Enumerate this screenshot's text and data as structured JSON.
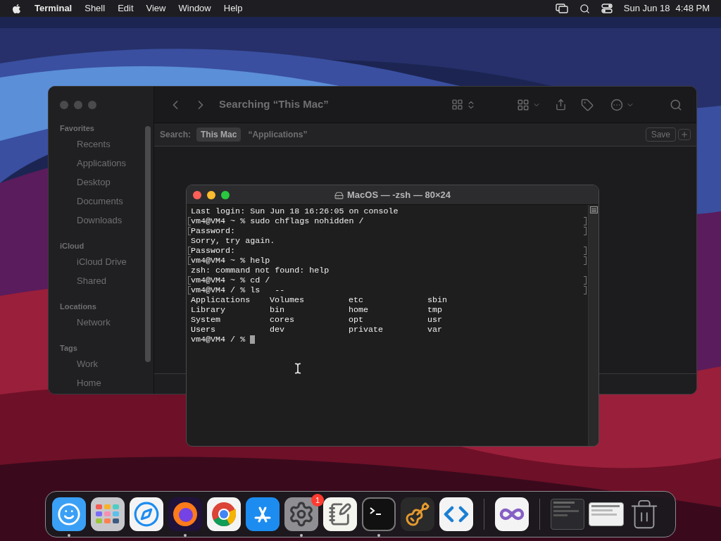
{
  "menu_bar": {
    "app_name": "Terminal",
    "menus": [
      "Shell",
      "Edit",
      "View",
      "Window",
      "Help"
    ],
    "date": "Sun Jun 18",
    "time": "4:48 PM"
  },
  "finder": {
    "title": "Searching “This Mac”",
    "search_label": "Search:",
    "scopes": [
      {
        "label": "This Mac",
        "selected": true
      },
      {
        "label": "“Applications”",
        "selected": false
      }
    ],
    "save": "Save",
    "sidebar": [
      {
        "heading": "Favorites",
        "items": [
          "Recents",
          "Applications",
          "Desktop",
          "Documents",
          "Downloads"
        ]
      },
      {
        "heading": "iCloud",
        "items": [
          "iCloud Drive",
          "Shared"
        ]
      },
      {
        "heading": "Locations",
        "items": [
          "Network"
        ]
      },
      {
        "heading": "Tags",
        "items": [
          "Work",
          "Home"
        ]
      }
    ]
  },
  "terminal": {
    "title": "MacOS — -zsh — 80×24",
    "lines": [
      {
        "text": "Last login: Sun Jun 18 16:26:05 on console",
        "marked": false
      },
      {
        "text": "vm4@VM4 ~ % sudo chflags nohidden /",
        "marked": true
      },
      {
        "text": "Password:",
        "marked": true
      },
      {
        "text": "Sorry, try again.",
        "marked": false
      },
      {
        "text": "Password:",
        "marked": true
      },
      {
        "text": "vm4@VM4 ~ % help",
        "marked": true
      },
      {
        "text": "zsh: command not found: help",
        "marked": false
      },
      {
        "text": "vm4@VM4 ~ % cd /",
        "marked": true
      },
      {
        "text": "vm4@VM4 / % ls   --",
        "marked": true
      }
    ],
    "listing": [
      [
        "Applications",
        "Volumes",
        "etc",
        "sbin"
      ],
      [
        "Library",
        "bin",
        "home",
        "tmp"
      ],
      [
        "System",
        "cores",
        "opt",
        "usr"
      ],
      [
        "Users",
        "dev",
        "private",
        "var"
      ]
    ],
    "prompt": "vm4@VM4 / %"
  },
  "dock": {
    "apps": [
      {
        "kind": "finder",
        "running": true
      },
      {
        "kind": "launchpad",
        "running": false
      },
      {
        "kind": "safari",
        "running": false
      },
      {
        "kind": "firefox",
        "running": true
      },
      {
        "kind": "chrome",
        "running": false
      },
      {
        "kind": "appstore",
        "running": false
      },
      {
        "kind": "settings",
        "running": true,
        "badge": "1"
      },
      {
        "kind": "textedit",
        "running": false
      },
      {
        "kind": "terminal",
        "running": true
      },
      {
        "kind": "garageband",
        "running": false
      },
      {
        "kind": "vscode",
        "running": false
      }
    ],
    "recent": [
      {
        "kind": "visualstudio",
        "running": false
      }
    ],
    "windows": [
      {
        "kind": "settings-window"
      },
      {
        "kind": "browser-window"
      }
    ]
  }
}
